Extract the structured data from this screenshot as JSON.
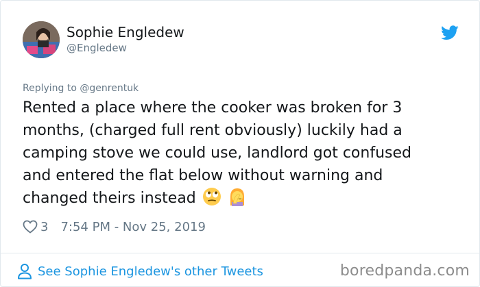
{
  "author": {
    "name": "Sophie Engledew",
    "handle": "@Engledew"
  },
  "reply": {
    "prefix": "Replying to",
    "to_handle": "@genrentuk"
  },
  "tweet": {
    "line1": "Rented a place where the cooker was broken for 3",
    "line2": "months, (charged full rent obviously) luckily had a",
    "line3": "camping stove we could use, landlord got confused",
    "line4": "and entered the flat below without warning and",
    "line5": "changed theirs instead",
    "emojis": [
      "face-with-rolling-eyes-emoji",
      "woman-facepalming-emoji"
    ]
  },
  "meta": {
    "like_count": "3",
    "timestamp": "7:54 PM - Nov 25, 2019"
  },
  "footer": {
    "link_label": "See Sophie Engledew's other Tweets",
    "watermark": "boredpanda.com"
  },
  "colors": {
    "twitter_blue": "#1da1f2",
    "link_blue": "#1b95e0",
    "secondary_text": "#657786",
    "border": "#e1e8ed"
  },
  "icons": [
    "avatar",
    "twitter-bird-icon",
    "heart-icon",
    "person-icon"
  ]
}
